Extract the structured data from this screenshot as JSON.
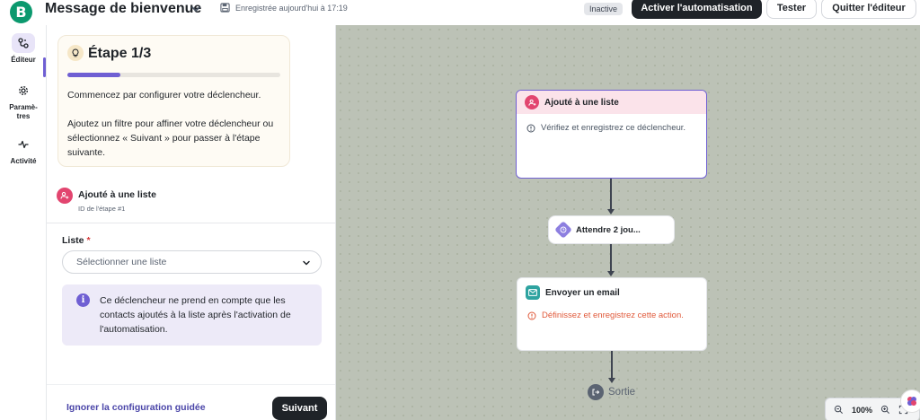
{
  "header": {
    "logo_letter": "B",
    "title": "Message de bienvenue",
    "saved_text": "Enregistrée aujourd'hui à 17:19",
    "status_badge": "Inactive",
    "activate_label": "Activer l'automatisation",
    "test_label": "Tester",
    "quit_label": "Quitter l'éditeur"
  },
  "nav": {
    "items": [
      {
        "label": "Éditeur",
        "icon": "workflow-icon",
        "active": true
      },
      {
        "label": "Paramè-tres",
        "icon": "gear-icon",
        "active": false
      },
      {
        "label": "Activité",
        "icon": "activity-icon",
        "active": false
      }
    ]
  },
  "guide": {
    "step_title": "Étape 1/3",
    "progress": 0.25,
    "text_1": "Commencez par configurer votre déclencheur.",
    "text_2": "Ajoutez un filtre pour affiner votre déclencheur ou sélectionnez « Suivant » pour passer à l'étape suivante."
  },
  "trigger": {
    "title": "Ajouté à une liste",
    "step_id": "ID de l'étape #1"
  },
  "form": {
    "list_label": "Liste",
    "required_mark": "*",
    "list_placeholder": "Sélectionner une liste",
    "info_text": "Ce déclencheur ne prend en compte que les contacts ajoutés à la liste après l'activation de l'automatisation."
  },
  "footer": {
    "skip_label": "Ignorer la configuration guidée",
    "next_label": "Suivant"
  },
  "canvas": {
    "trigger_node": {
      "title": "Ajouté à une liste",
      "message": "Vérifiez et enregistrez ce déclencheur."
    },
    "wait_node": {
      "title": "Attendre 2 jou..."
    },
    "email_node": {
      "title": "Envoyer un email",
      "warning": "Définissez et enregistrez cette action."
    },
    "exit_label": "Sortie",
    "zoom_level": "100%"
  },
  "colors": {
    "accent": "#6f5fd3",
    "brand": "#0b996e",
    "trigger_pink": "#e2456f",
    "email_teal": "#2ea3a0",
    "warning": "#e0593a",
    "canvas_bg": "#bcc2b6"
  }
}
